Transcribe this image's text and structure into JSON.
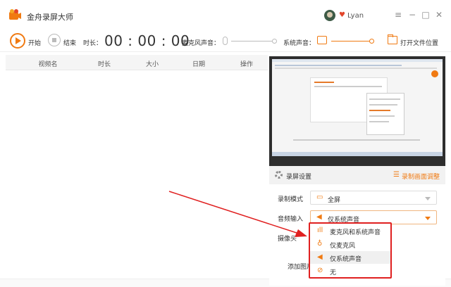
{
  "app": {
    "title": "金舟录屏大师",
    "username": "Lyan"
  },
  "window_controls": {
    "menu": "≡",
    "minimize": "−",
    "maximize": "□",
    "close": "✕"
  },
  "toolbar": {
    "start_label": "开始",
    "stop_label": "结束",
    "duration_label": "时长：",
    "timer": "00 : 00 : 00",
    "mic_label": "麦克风声音：",
    "system_label": "系统声音：",
    "open_folder_label": "打开文件位置"
  },
  "table": {
    "columns": [
      "视频名",
      "时长",
      "大小",
      "日期",
      "操作"
    ]
  },
  "settings": {
    "title": "录屏设置",
    "adjust_link": "录制画面调整",
    "record_mode_label": "录制模式",
    "record_mode_value": "全屏",
    "audio_input_label": "音频输入",
    "audio_input_value": "仅系统声音",
    "camera_label": "摄像头",
    "add_image_label": "添加图片"
  },
  "audio_options": [
    {
      "label": "麦克风和系统声音",
      "icon": "mic-system-icon"
    },
    {
      "label": "仅麦克风",
      "icon": "microphone-icon"
    },
    {
      "label": "仅系统声音",
      "icon": "speaker-icon",
      "selected": true
    },
    {
      "label": "无",
      "icon": "none-icon"
    }
  ],
  "colors": {
    "accent": "#f07a12",
    "annotation": "#e02020"
  }
}
